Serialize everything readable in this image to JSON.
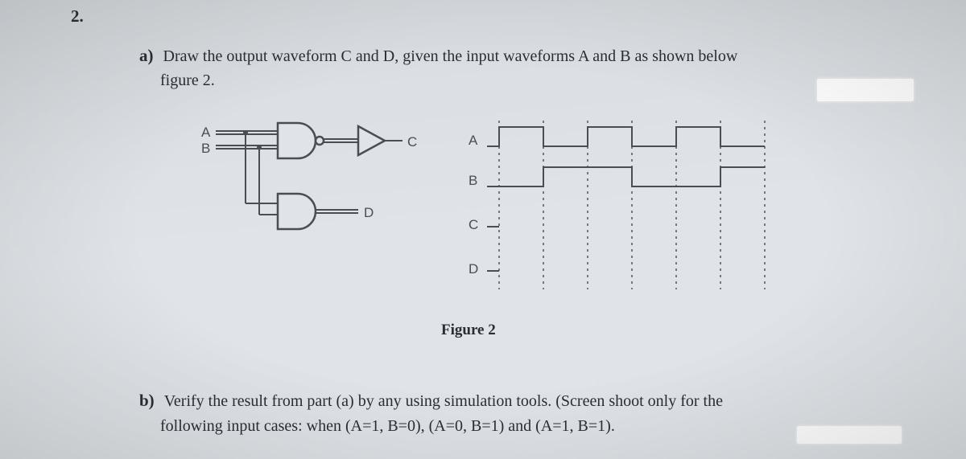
{
  "question_number": "2.",
  "part_a": {
    "label": "a)",
    "line1": "Draw the output waveform C and D, given the input waveforms A and B as shown below",
    "line2": "figure 2."
  },
  "circuit": {
    "input_a": "A",
    "input_b": "B",
    "output_c": "C",
    "output_d": "D"
  },
  "waveforms": {
    "row_a": "A",
    "row_b": "B",
    "row_c": "C",
    "row_d": "D"
  },
  "figure_caption": "Figure 2",
  "part_b": {
    "label": "b)",
    "line1": "Verify the result from part (a) by any using simulation tools. (Screen shoot only for the",
    "line2": "following input cases: when (A=1, B=0), (A=0, B=1) and (A=1, B=1)."
  }
}
